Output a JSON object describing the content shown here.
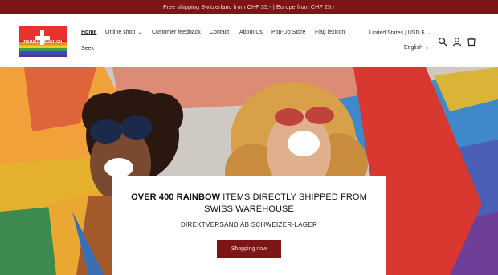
{
  "announcement": {
    "text": "Free shipping Switzerland from CHF 35.- | Europe from CHF 25.-"
  },
  "logo": {
    "text": "RAINBOWSHOP.CH"
  },
  "nav": {
    "items": [
      {
        "label": "Home",
        "active": true
      },
      {
        "label": "Online shop",
        "has_dropdown": true
      },
      {
        "label": "Customer feedback"
      },
      {
        "label": "Contact"
      },
      {
        "label": "About Us"
      },
      {
        "label": "Pop-Up Store"
      },
      {
        "label": "Flag lexicon"
      },
      {
        "label": "Seek"
      }
    ]
  },
  "locale": {
    "currency": "United States | USD $",
    "language": "English"
  },
  "icons": {
    "search": "search-icon",
    "account": "account-icon",
    "cart": "cart-icon"
  },
  "hero": {
    "headline_bold": "OVER 400 RAINBOW",
    "headline_rest": " ITEMS DIRECTLY SHIPPED FROM SWISS WAREHOUSE",
    "subline": "DIREKTVERSAND AB SCHWEIZER-LAGER",
    "cta_label": "Shopping now"
  },
  "colors": {
    "brand": "#7d1517",
    "announcement_text": "#f3d9d9"
  }
}
